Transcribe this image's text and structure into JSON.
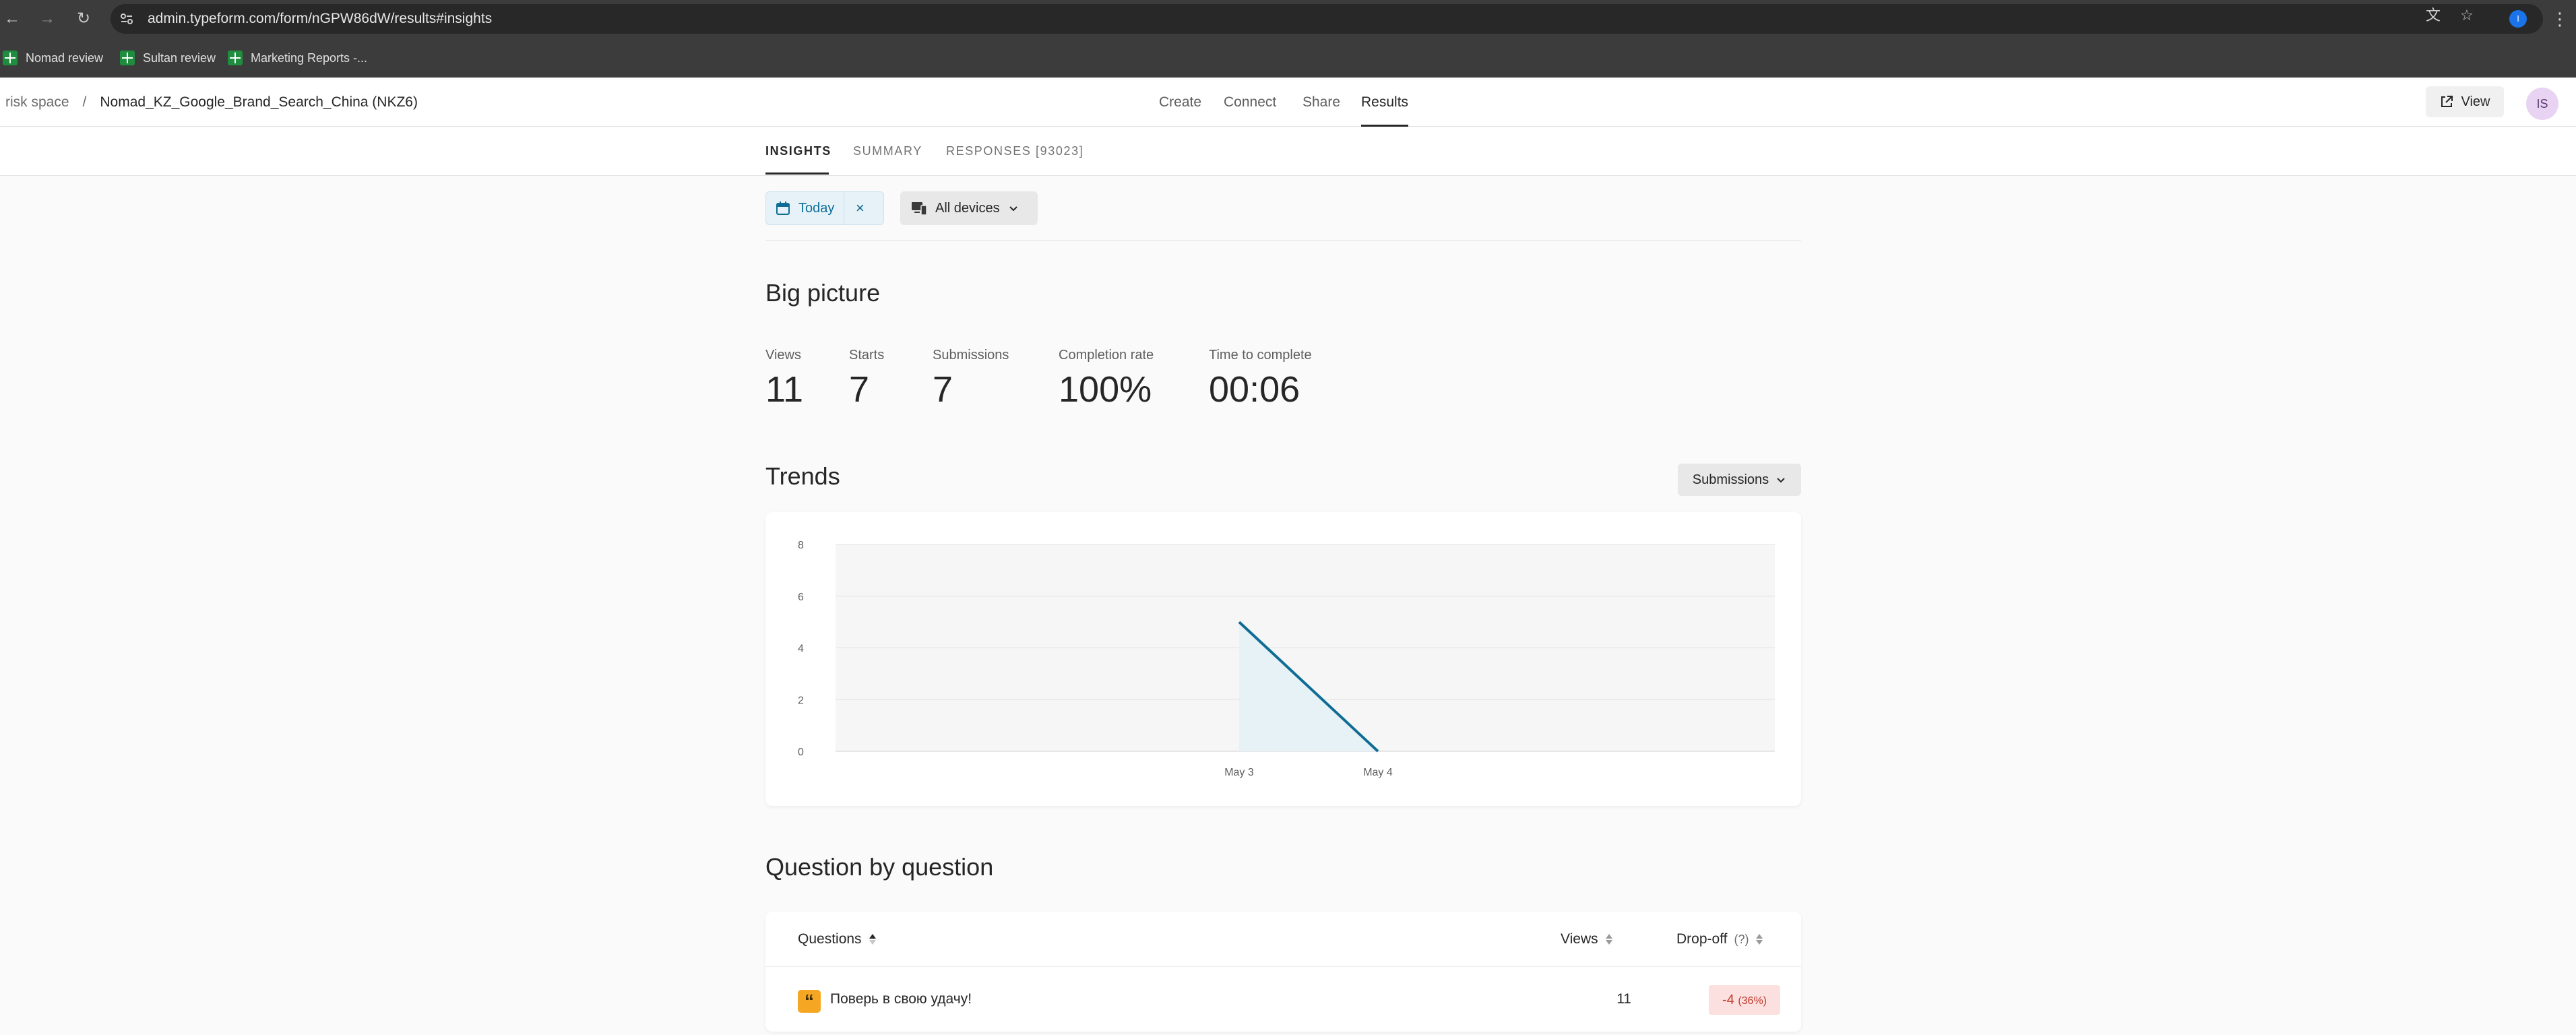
{
  "browser": {
    "url": "admin.typeform.com/form/nGPW86dW/results#insights",
    "profile_initial": "I",
    "bookmarks": [
      {
        "label": "Nomad review"
      },
      {
        "label": "Sultan review"
      },
      {
        "label": "Marketing Reports -..."
      }
    ]
  },
  "header": {
    "workspace": "risk space",
    "separator": "/",
    "form_name": "Nomad_KZ_Google_Brand_Search_China (NKZ6)",
    "nav": [
      "Create",
      "Connect",
      "Share",
      "Results"
    ],
    "active_nav": "Results",
    "view_label": "View",
    "avatar_initials": "IS"
  },
  "subtabs": {
    "insights": "INSIGHTS",
    "summary": "SUMMARY",
    "responses": "RESPONSES [93023]"
  },
  "filters": {
    "date_label": "Today",
    "clear_symbol": "×",
    "device_label": "All devices"
  },
  "big_picture": {
    "title": "Big picture",
    "metrics": [
      {
        "label": "Views",
        "value": "11"
      },
      {
        "label": "Starts",
        "value": "7"
      },
      {
        "label": "Submissions",
        "value": "7"
      },
      {
        "label": "Completion rate",
        "value": "100%"
      },
      {
        "label": "Time to complete",
        "value": "00:06"
      }
    ]
  },
  "trends": {
    "title": "Trends",
    "dropdown_label": "Submissions"
  },
  "chart_data": {
    "type": "area",
    "x": [
      "May 3",
      "May 4"
    ],
    "series": [
      {
        "values": [
          5,
          0
        ]
      }
    ],
    "xlabel": "",
    "ylabel": "",
    "ylim": [
      0,
      8
    ],
    "yticks": [
      0,
      2,
      4,
      6,
      8
    ],
    "grid": true,
    "line_color": "#0f6d95",
    "fill_color": "#e6f2f7"
  },
  "questions": {
    "title": "Question by question",
    "columns": {
      "questions": "Questions",
      "views": "Views",
      "dropoff": "Drop-off",
      "dropoff_hint": "(?)"
    },
    "rows": [
      {
        "icon": "quote-icon",
        "text": "Поверь в свою удачу!",
        "views": "11",
        "dropoff": "-4",
        "dropoff_pct": "(36%)"
      }
    ]
  }
}
